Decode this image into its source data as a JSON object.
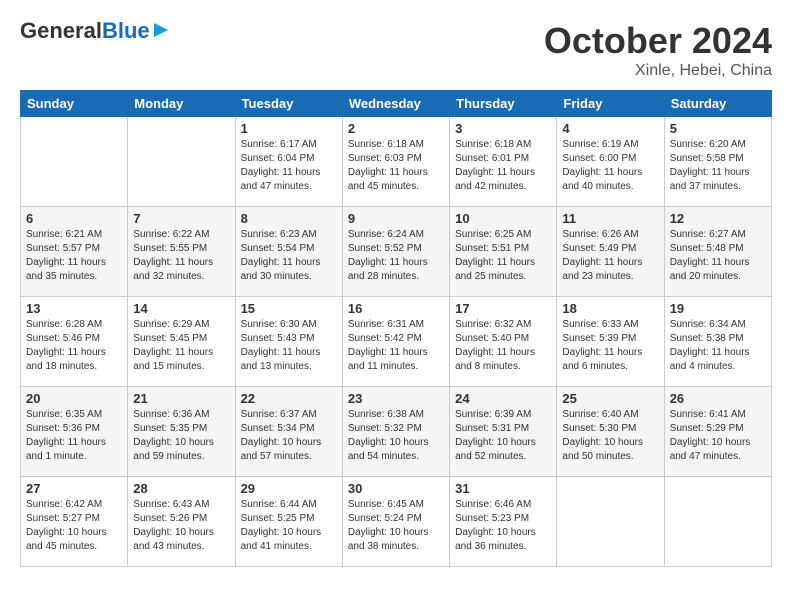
{
  "header": {
    "logo_general": "General",
    "logo_blue": "Blue",
    "month_title": "October 2024",
    "location": "Xinle, Hebei, China"
  },
  "weekdays": [
    "Sunday",
    "Monday",
    "Tuesday",
    "Wednesday",
    "Thursday",
    "Friday",
    "Saturday"
  ],
  "weeks": [
    [
      {
        "day": "",
        "sunrise": "",
        "sunset": "",
        "daylight": ""
      },
      {
        "day": "",
        "sunrise": "",
        "sunset": "",
        "daylight": ""
      },
      {
        "day": "1",
        "sunrise": "Sunrise: 6:17 AM",
        "sunset": "Sunset: 6:04 PM",
        "daylight": "Daylight: 11 hours and 47 minutes."
      },
      {
        "day": "2",
        "sunrise": "Sunrise: 6:18 AM",
        "sunset": "Sunset: 6:03 PM",
        "daylight": "Daylight: 11 hours and 45 minutes."
      },
      {
        "day": "3",
        "sunrise": "Sunrise: 6:18 AM",
        "sunset": "Sunset: 6:01 PM",
        "daylight": "Daylight: 11 hours and 42 minutes."
      },
      {
        "day": "4",
        "sunrise": "Sunrise: 6:19 AM",
        "sunset": "Sunset: 6:00 PM",
        "daylight": "Daylight: 11 hours and 40 minutes."
      },
      {
        "day": "5",
        "sunrise": "Sunrise: 6:20 AM",
        "sunset": "Sunset: 5:58 PM",
        "daylight": "Daylight: 11 hours and 37 minutes."
      }
    ],
    [
      {
        "day": "6",
        "sunrise": "Sunrise: 6:21 AM",
        "sunset": "Sunset: 5:57 PM",
        "daylight": "Daylight: 11 hours and 35 minutes."
      },
      {
        "day": "7",
        "sunrise": "Sunrise: 6:22 AM",
        "sunset": "Sunset: 5:55 PM",
        "daylight": "Daylight: 11 hours and 32 minutes."
      },
      {
        "day": "8",
        "sunrise": "Sunrise: 6:23 AM",
        "sunset": "Sunset: 5:54 PM",
        "daylight": "Daylight: 11 hours and 30 minutes."
      },
      {
        "day": "9",
        "sunrise": "Sunrise: 6:24 AM",
        "sunset": "Sunset: 5:52 PM",
        "daylight": "Daylight: 11 hours and 28 minutes."
      },
      {
        "day": "10",
        "sunrise": "Sunrise: 6:25 AM",
        "sunset": "Sunset: 5:51 PM",
        "daylight": "Daylight: 11 hours and 25 minutes."
      },
      {
        "day": "11",
        "sunrise": "Sunrise: 6:26 AM",
        "sunset": "Sunset: 5:49 PM",
        "daylight": "Daylight: 11 hours and 23 minutes."
      },
      {
        "day": "12",
        "sunrise": "Sunrise: 6:27 AM",
        "sunset": "Sunset: 5:48 PM",
        "daylight": "Daylight: 11 hours and 20 minutes."
      }
    ],
    [
      {
        "day": "13",
        "sunrise": "Sunrise: 6:28 AM",
        "sunset": "Sunset: 5:46 PM",
        "daylight": "Daylight: 11 hours and 18 minutes."
      },
      {
        "day": "14",
        "sunrise": "Sunrise: 6:29 AM",
        "sunset": "Sunset: 5:45 PM",
        "daylight": "Daylight: 11 hours and 15 minutes."
      },
      {
        "day": "15",
        "sunrise": "Sunrise: 6:30 AM",
        "sunset": "Sunset: 5:43 PM",
        "daylight": "Daylight: 11 hours and 13 minutes."
      },
      {
        "day": "16",
        "sunrise": "Sunrise: 6:31 AM",
        "sunset": "Sunset: 5:42 PM",
        "daylight": "Daylight: 11 hours and 11 minutes."
      },
      {
        "day": "17",
        "sunrise": "Sunrise: 6:32 AM",
        "sunset": "Sunset: 5:40 PM",
        "daylight": "Daylight: 11 hours and 8 minutes."
      },
      {
        "day": "18",
        "sunrise": "Sunrise: 6:33 AM",
        "sunset": "Sunset: 5:39 PM",
        "daylight": "Daylight: 11 hours and 6 minutes."
      },
      {
        "day": "19",
        "sunrise": "Sunrise: 6:34 AM",
        "sunset": "Sunset: 5:38 PM",
        "daylight": "Daylight: 11 hours and 4 minutes."
      }
    ],
    [
      {
        "day": "20",
        "sunrise": "Sunrise: 6:35 AM",
        "sunset": "Sunset: 5:36 PM",
        "daylight": "Daylight: 11 hours and 1 minute."
      },
      {
        "day": "21",
        "sunrise": "Sunrise: 6:36 AM",
        "sunset": "Sunset: 5:35 PM",
        "daylight": "Daylight: 10 hours and 59 minutes."
      },
      {
        "day": "22",
        "sunrise": "Sunrise: 6:37 AM",
        "sunset": "Sunset: 5:34 PM",
        "daylight": "Daylight: 10 hours and 57 minutes."
      },
      {
        "day": "23",
        "sunrise": "Sunrise: 6:38 AM",
        "sunset": "Sunset: 5:32 PM",
        "daylight": "Daylight: 10 hours and 54 minutes."
      },
      {
        "day": "24",
        "sunrise": "Sunrise: 6:39 AM",
        "sunset": "Sunset: 5:31 PM",
        "daylight": "Daylight: 10 hours and 52 minutes."
      },
      {
        "day": "25",
        "sunrise": "Sunrise: 6:40 AM",
        "sunset": "Sunset: 5:30 PM",
        "daylight": "Daylight: 10 hours and 50 minutes."
      },
      {
        "day": "26",
        "sunrise": "Sunrise: 6:41 AM",
        "sunset": "Sunset: 5:29 PM",
        "daylight": "Daylight: 10 hours and 47 minutes."
      }
    ],
    [
      {
        "day": "27",
        "sunrise": "Sunrise: 6:42 AM",
        "sunset": "Sunset: 5:27 PM",
        "daylight": "Daylight: 10 hours and 45 minutes."
      },
      {
        "day": "28",
        "sunrise": "Sunrise: 6:43 AM",
        "sunset": "Sunset: 5:26 PM",
        "daylight": "Daylight: 10 hours and 43 minutes."
      },
      {
        "day": "29",
        "sunrise": "Sunrise: 6:44 AM",
        "sunset": "Sunset: 5:25 PM",
        "daylight": "Daylight: 10 hours and 41 minutes."
      },
      {
        "day": "30",
        "sunrise": "Sunrise: 6:45 AM",
        "sunset": "Sunset: 5:24 PM",
        "daylight": "Daylight: 10 hours and 38 minutes."
      },
      {
        "day": "31",
        "sunrise": "Sunrise: 6:46 AM",
        "sunset": "Sunset: 5:23 PM",
        "daylight": "Daylight: 10 hours and 36 minutes."
      },
      {
        "day": "",
        "sunrise": "",
        "sunset": "",
        "daylight": ""
      },
      {
        "day": "",
        "sunrise": "",
        "sunset": "",
        "daylight": ""
      }
    ]
  ]
}
